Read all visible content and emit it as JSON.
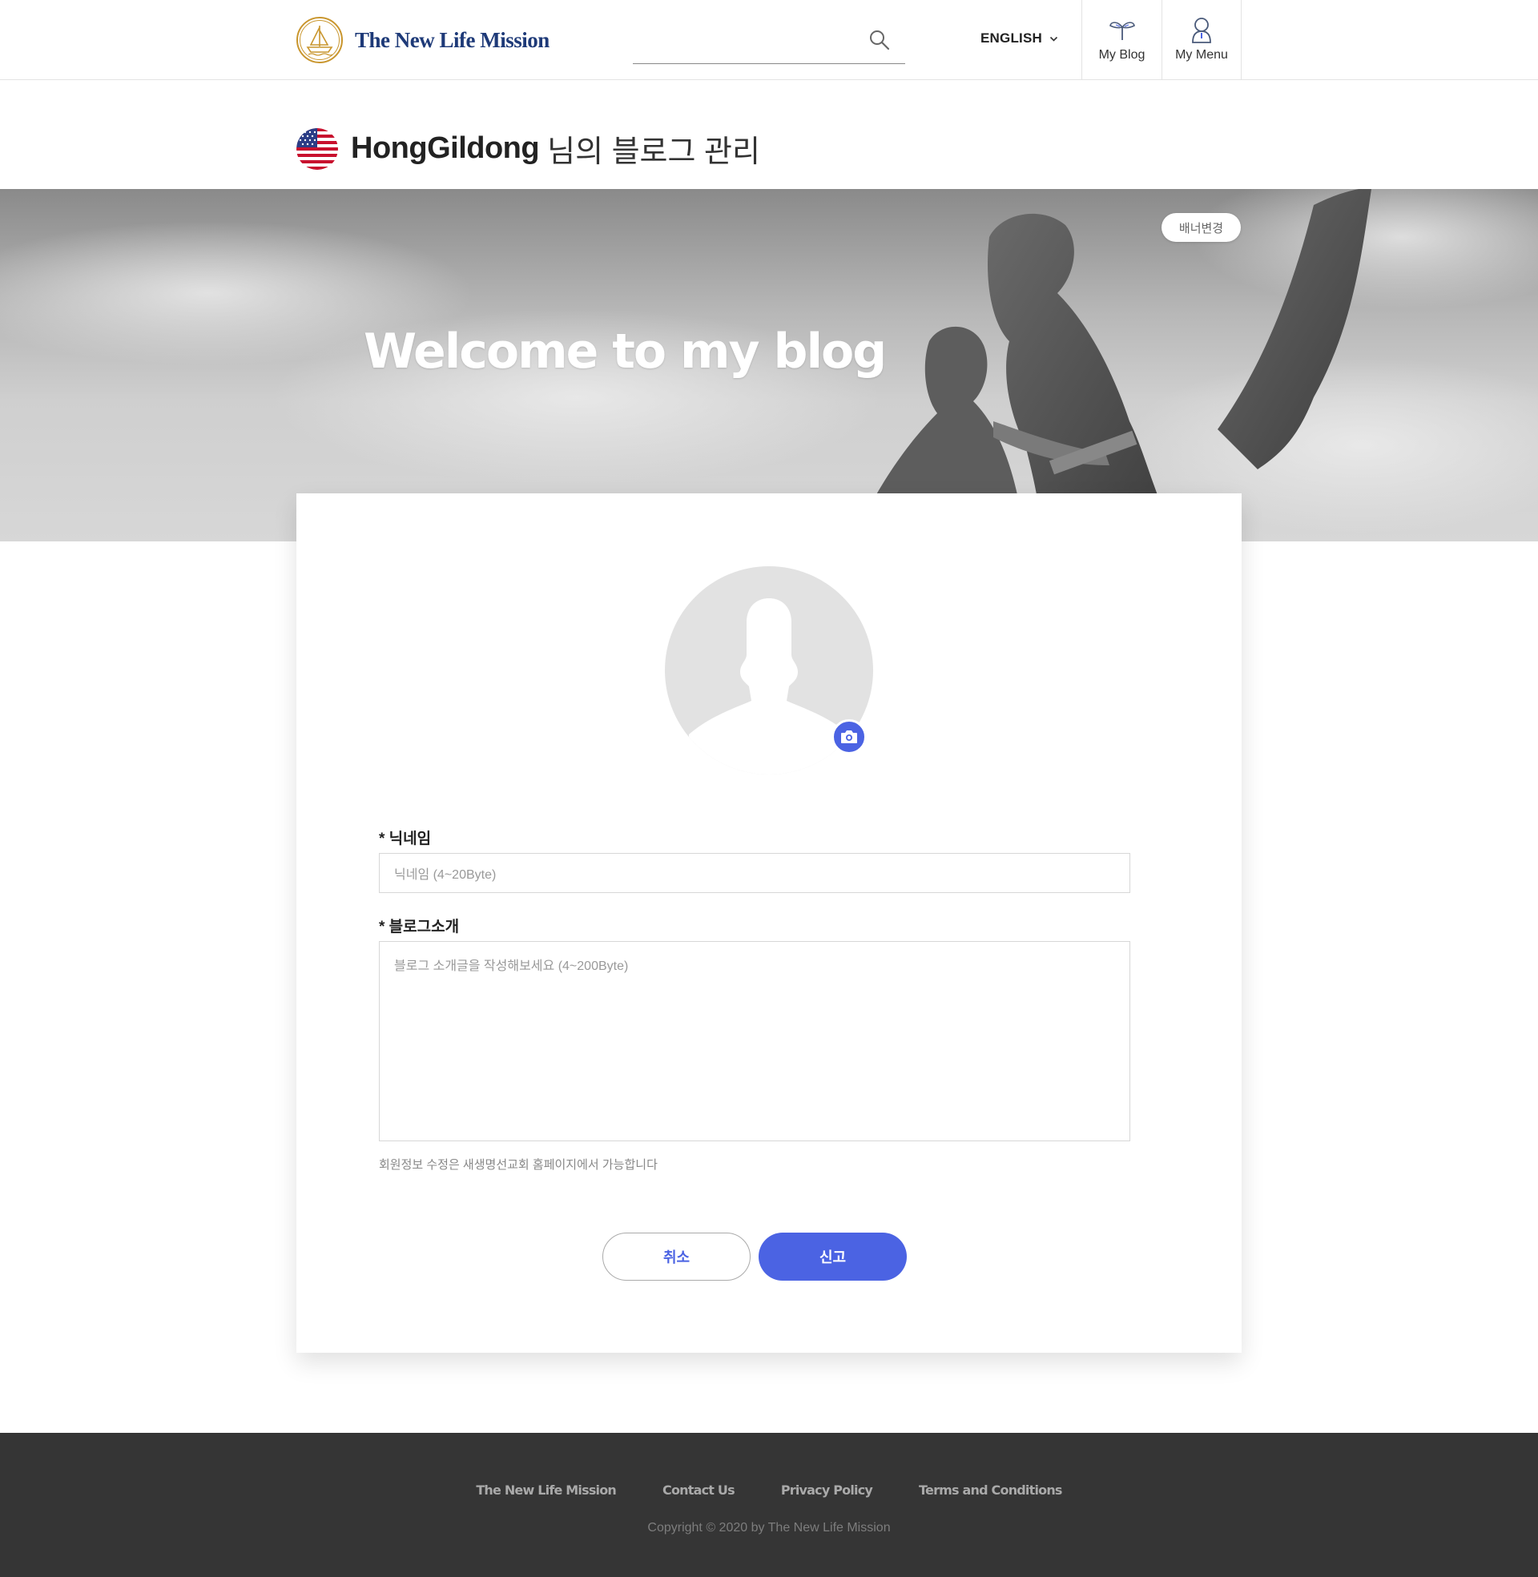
{
  "header": {
    "logo_text": "The New Life Mission",
    "search_placeholder": "",
    "language": "ENGLISH",
    "my_blog_label": "My Blog",
    "my_menu_label": "My Menu"
  },
  "title": {
    "username": "HongGildong",
    "suffix": "님의 블로그 관리"
  },
  "banner": {
    "headline": "Welcome to my blog",
    "change_button": "배너변경"
  },
  "form": {
    "nickname_label": "* 닉네임",
    "nickname_placeholder": "닉네임 (4~20Byte)",
    "intro_label": "* 블로그소개",
    "intro_placeholder": "블로그 소개글을 작성해보세요 (4~200Byte)",
    "note": "회원정보 수정은 새생명선교회 홈페이지에서 가능합니다",
    "cancel_label": "취소",
    "submit_label": "신고"
  },
  "footer": {
    "links": [
      "The New Life Mission",
      "Contact Us",
      "Privacy Policy",
      "Terms and Conditions"
    ],
    "copyright": "Copyright © 2020 by The New Life Mission"
  },
  "colors": {
    "accent": "#4b63e3",
    "logo_blue": "#1e3a78",
    "logo_gold": "#c9962e",
    "footer_bg": "#353535"
  },
  "icons": {
    "search": "search-icon",
    "dropdown": "chevron-down-icon",
    "my_blog": "sprout-icon",
    "my_menu": "person-icon",
    "camera": "camera-icon",
    "flag": "us-flag-icon"
  }
}
